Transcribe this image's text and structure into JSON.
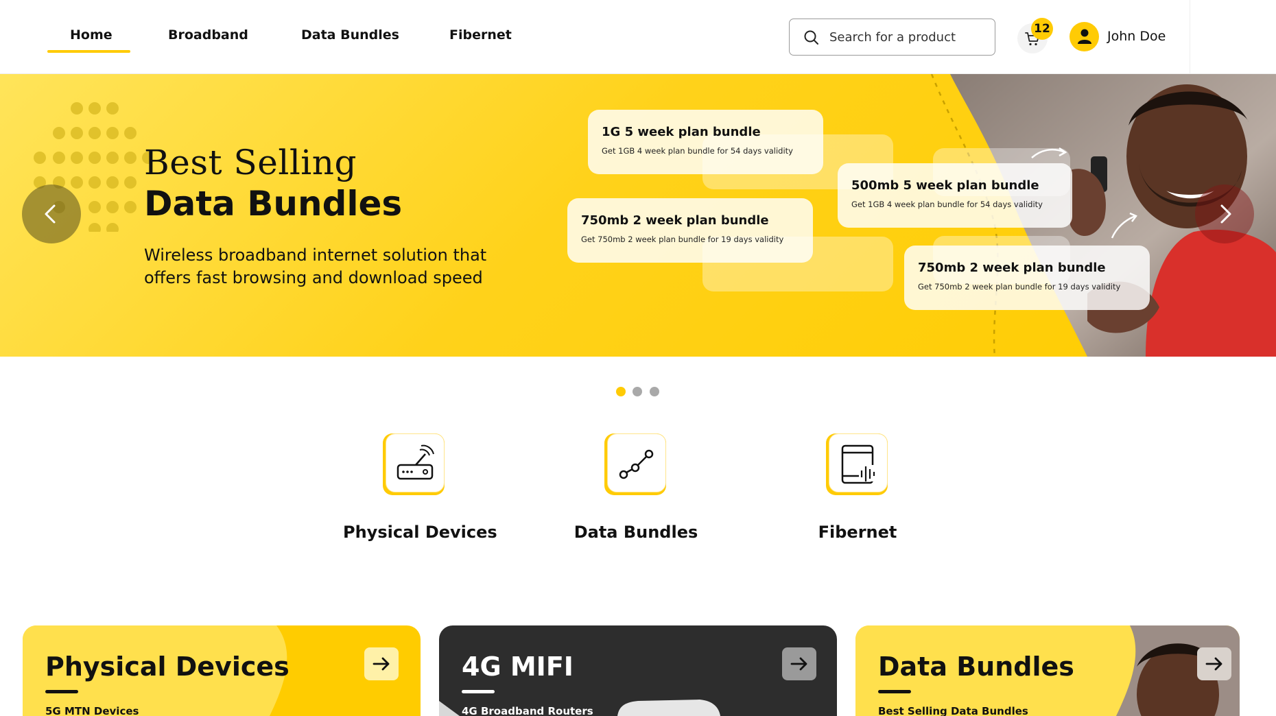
{
  "header": {
    "nav": [
      {
        "label": "Home",
        "active": true
      },
      {
        "label": "Broadband"
      },
      {
        "label": "Data Bundles"
      },
      {
        "label": "Fibernet"
      }
    ],
    "search": {
      "placeholder": "Search for a product",
      "icon": "search-icon"
    },
    "cart": {
      "count": "12",
      "icon": "cart-icon"
    },
    "user": {
      "name": "John Doe",
      "icon": "user-icon"
    }
  },
  "hero": {
    "title_line1": "Best Selling",
    "title_line2": "Data Bundles",
    "description": "Wireless broadband internet solution that offers fast browsing and download speed",
    "bundles": [
      {
        "title": "1G 5 week plan bundle",
        "subtitle": "Get 1GB 4 week plan bundle for 54 days validity"
      },
      {
        "title": "500mb 5 week plan bundle",
        "subtitle": "Get 1GB 4 week plan bundle for 54 days validity"
      },
      {
        "title": "750mb 2 week plan bundle",
        "subtitle": "Get 750mb 2 week plan bundle for 19 days validity"
      },
      {
        "title": "750mb 2 week plan bundle",
        "subtitle": "Get 750mb 2 week plan bundle for 19 days validity"
      }
    ],
    "slides": 3,
    "active_slide": 1
  },
  "categories": [
    {
      "label": "Physical Devices",
      "icon": "router-icon"
    },
    {
      "label": "Data Bundles",
      "icon": "data-bundle-icon"
    },
    {
      "label": "Fibernet",
      "icon": "fibernet-icon"
    }
  ],
  "cards": [
    {
      "title": "Physical Devices",
      "subtitle": "5G MTN Devices",
      "theme": "yellow"
    },
    {
      "title": "4G MIFI",
      "subtitle": "4G Broadband Routers",
      "theme": "dark"
    },
    {
      "title": "Data Bundles",
      "subtitle": "Best Selling Data Bundles",
      "theme": "yellow"
    }
  ],
  "colors": {
    "accent": "#ffcb05",
    "dark": "#2d2d2d",
    "text": "#111111"
  }
}
